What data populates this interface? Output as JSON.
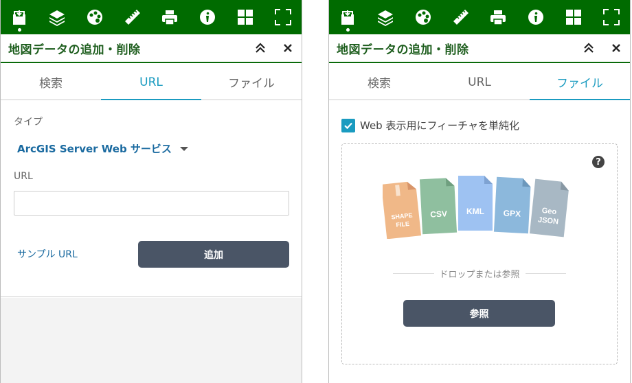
{
  "toolbar": {
    "tools": [
      {
        "icon": "add-data-icon",
        "active": true
      },
      {
        "icon": "layers-icon"
      },
      {
        "icon": "basemap-icon"
      },
      {
        "icon": "measure-icon"
      },
      {
        "icon": "print-icon"
      },
      {
        "icon": "info-icon"
      },
      {
        "icon": "grid-icon"
      },
      {
        "icon": "fullscreen-icon"
      }
    ],
    "color": "#006b00"
  },
  "panel": {
    "title": "地図データの追加・削除",
    "tabs": [
      "検索",
      "URL",
      "ファイル"
    ]
  },
  "url_tab": {
    "type_label": "タイプ",
    "type_value": "ArcGIS Server Web サービス",
    "url_label": "URL",
    "url_value": "",
    "sample_link": "サンプル URL",
    "add_button": "追加"
  },
  "file_tab": {
    "simplify_checkbox_label": "Web 表示用にフィーチャを単純化",
    "simplify_checked": true,
    "help_icon": "?",
    "file_types": [
      {
        "label": "SHAPE FILE",
        "color": "#f0b888"
      },
      {
        "label": "CSV",
        "color": "#8fbf9f"
      },
      {
        "label": "KML",
        "color": "#9ec2f2"
      },
      {
        "label": "GPX",
        "color": "#8cb8dc"
      },
      {
        "label": "Geo JSON",
        "color": "#a8b8c4"
      }
    ],
    "drop_text": "ドロップまたは参照",
    "browse_button": "参照"
  },
  "colors": {
    "accent": "#1a9bc0",
    "title_text": "#1e5e1e",
    "button_dark": "#4a5566",
    "link": "#1a6aa0"
  }
}
